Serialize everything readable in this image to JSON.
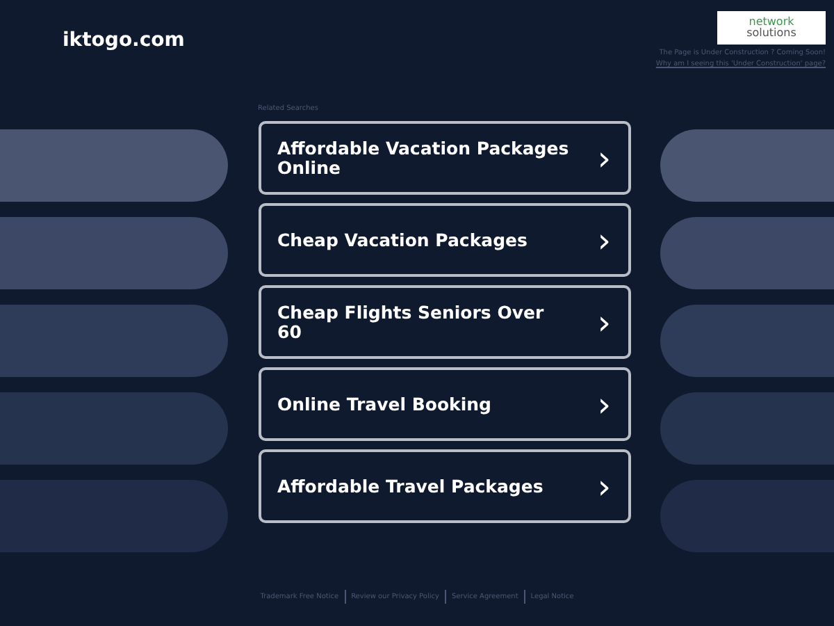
{
  "header": {
    "domain": "iktogo.com",
    "logo": [
      "network",
      "solutions"
    ],
    "notice": "The Page is Under Construction ? Coming Soon!",
    "notice_link": "Why am I seeing this 'Under Construction' page?"
  },
  "related": {
    "heading": "Related Searches",
    "items": [
      {
        "label": "Affordable Vacation Packages Online",
        "arrow": "›"
      },
      {
        "label": "Cheap Vacation Packages",
        "arrow": "›"
      },
      {
        "label": "Cheap Flights Seniors Over 60",
        "arrow": "›"
      },
      {
        "label": "Online Travel Booking",
        "arrow": "›"
      },
      {
        "label": "Affordable Travel Packages",
        "arrow": "›"
      }
    ]
  },
  "footer": [
    "Trademark Free Notice",
    "Review our Privacy Policy",
    "Service Agreement",
    "Legal Notice"
  ]
}
